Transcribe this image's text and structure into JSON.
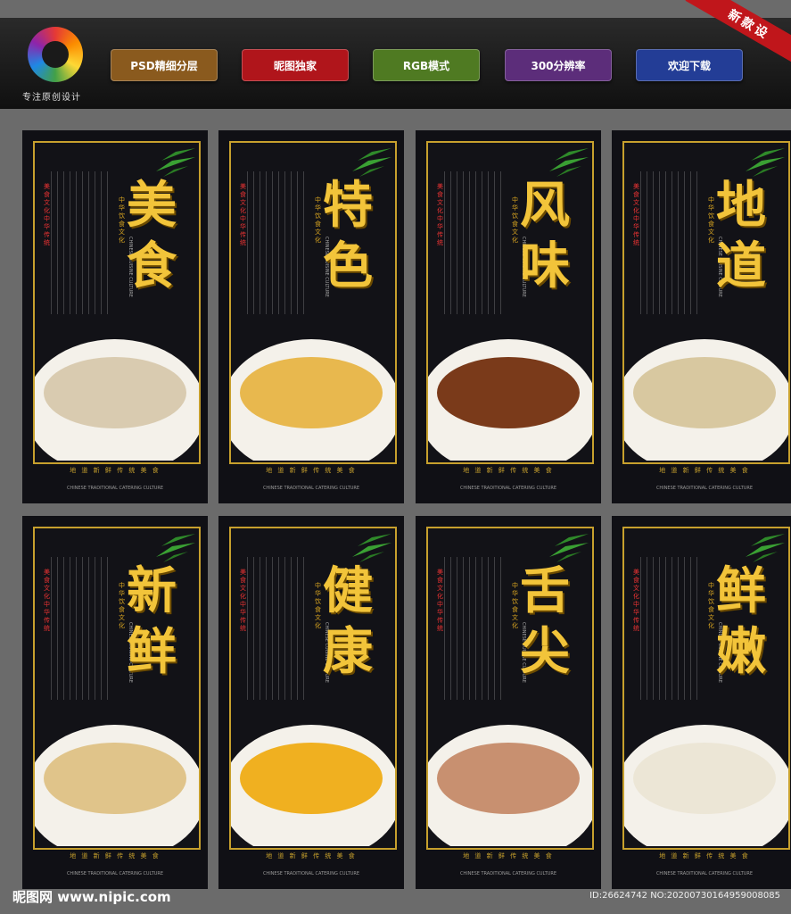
{
  "header": {
    "logo_text": "专注原创设计",
    "badges": [
      {
        "label": "PSD精细分层",
        "color": "#8a5a1e"
      },
      {
        "label": "昵图独家",
        "color": "#b0151b"
      },
      {
        "label": "RGB模式",
        "color": "#4f7a22"
      },
      {
        "label": "300分辨率",
        "color": "#5c2d7a"
      },
      {
        "label": "欢迎下载",
        "color": "#233d96"
      }
    ],
    "ribbon": "新款设"
  },
  "posters": [
    {
      "title_line1": "美",
      "title_line2": "食",
      "soup": "#d9cbb0"
    },
    {
      "title_line1": "特",
      "title_line2": "色",
      "soup": "#e8b84e"
    },
    {
      "title_line1": "风",
      "title_line2": "味",
      "soup": "#7a3a1a"
    },
    {
      "title_line1": "地",
      "title_line2": "道",
      "soup": "#d8c8a0"
    },
    {
      "title_line1": "新",
      "title_line2": "鲜",
      "soup": "#e0c48a"
    },
    {
      "title_line1": "健",
      "title_line2": "康",
      "soup": "#f0b020"
    },
    {
      "title_line1": "舌",
      "title_line2": "尖",
      "soup": "#c89070"
    },
    {
      "title_line1": "鲜",
      "title_line2": "嫩",
      "soup": "#ece6d6"
    }
  ],
  "poster_common": {
    "red_label": "美食文化中华传统",
    "gold_label": "中华饮食文化",
    "en_side": "CHINESE CUISINE CULTURE",
    "slogan": "地 道 新 鲜 传 统 美 食",
    "slogan_en": "CHINESE TRADITIONAL CATERING CULTURE"
  },
  "watermark": {
    "left": "昵图网 www.nipic.com",
    "right": "ID:26624742 NO:20200730164959008085"
  }
}
